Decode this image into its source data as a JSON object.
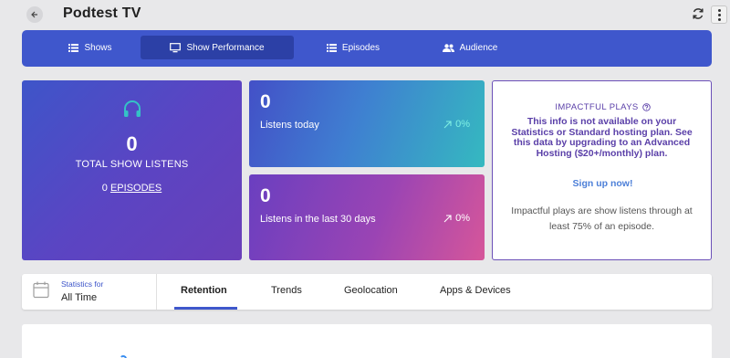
{
  "header": {
    "title": "Podtest TV"
  },
  "nav": {
    "items": [
      {
        "label": "Shows",
        "icon": "list-icon"
      },
      {
        "label": "Show Performance",
        "icon": "monitor-icon",
        "active": true
      },
      {
        "label": "Episodes",
        "icon": "list-icon"
      },
      {
        "label": "Audience",
        "icon": "people-icon"
      }
    ]
  },
  "total_card": {
    "value": "0",
    "label": "TOTAL SHOW LISTENS",
    "episodes_count": "0",
    "episodes_label": "EPISODES",
    "icon": "headphones-icon"
  },
  "today_card": {
    "value": "0",
    "label": "Listens today",
    "change": "0%"
  },
  "last30_card": {
    "value": "0",
    "label": "Listens in the last 30 days",
    "change": "0%"
  },
  "impact_card": {
    "title": "IMPACTFUL PLAYS",
    "body": "This info is not available on your Statistics or Standard hosting plan. See this data by upgrading to an Advanced Hosting ($20+/monthly) plan.",
    "cta": "Sign up now!",
    "note": "Impactful plays are show listens through at least 75% of an episode."
  },
  "stats": {
    "for_label": "Statistics for",
    "range": "All Time",
    "tabs": [
      "Retention",
      "Trends",
      "Geolocation",
      "Apps & Devices"
    ],
    "active_tab": "Retention"
  },
  "colors": {
    "nav_bg": "#3f57cc",
    "accent_purple": "#5a3fa8",
    "link_blue": "#4c7fd8",
    "teal": "#34c2c6"
  }
}
